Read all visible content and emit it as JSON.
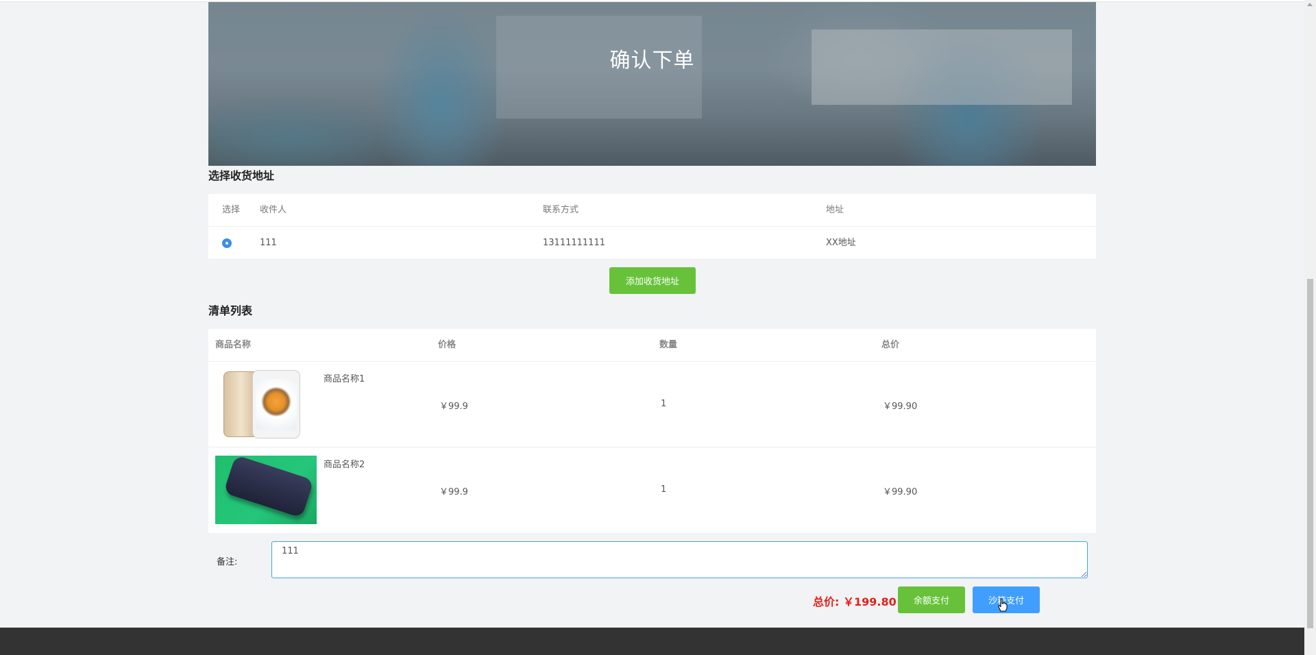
{
  "banner": {
    "title": "确认下单"
  },
  "address_section": {
    "title": "选择收货地址",
    "columns": [
      "选择",
      "收件人",
      "联系方式",
      "地址"
    ],
    "rows": [
      {
        "selected": true,
        "recipient": "111",
        "phone": "13111111111",
        "address": "XX地址"
      }
    ],
    "add_button": "添加收货地址"
  },
  "order_section": {
    "title": "清单列表",
    "columns": [
      "商品名称",
      "价格",
      "数量",
      "总价"
    ],
    "items": [
      {
        "image": "iphone-gold",
        "name": "商品名称1",
        "price": "￥99.9",
        "quantity": "1",
        "total": "￥99.90"
      },
      {
        "image": "phone-case-dark",
        "name": "商品名称2",
        "price": "￥99.9",
        "quantity": "1",
        "total": "￥99.90"
      }
    ]
  },
  "remark": {
    "label": "备注:",
    "value": "111"
  },
  "checkout": {
    "total_label": "总价: ￥199.80",
    "balance_pay_button": "余额支付",
    "sandbox_pay_button": "沙箱支付"
  },
  "colors": {
    "primary_green": "#67c23a",
    "primary_blue": "#409eff",
    "total_red": "#e0211b",
    "footer": "#333333"
  }
}
